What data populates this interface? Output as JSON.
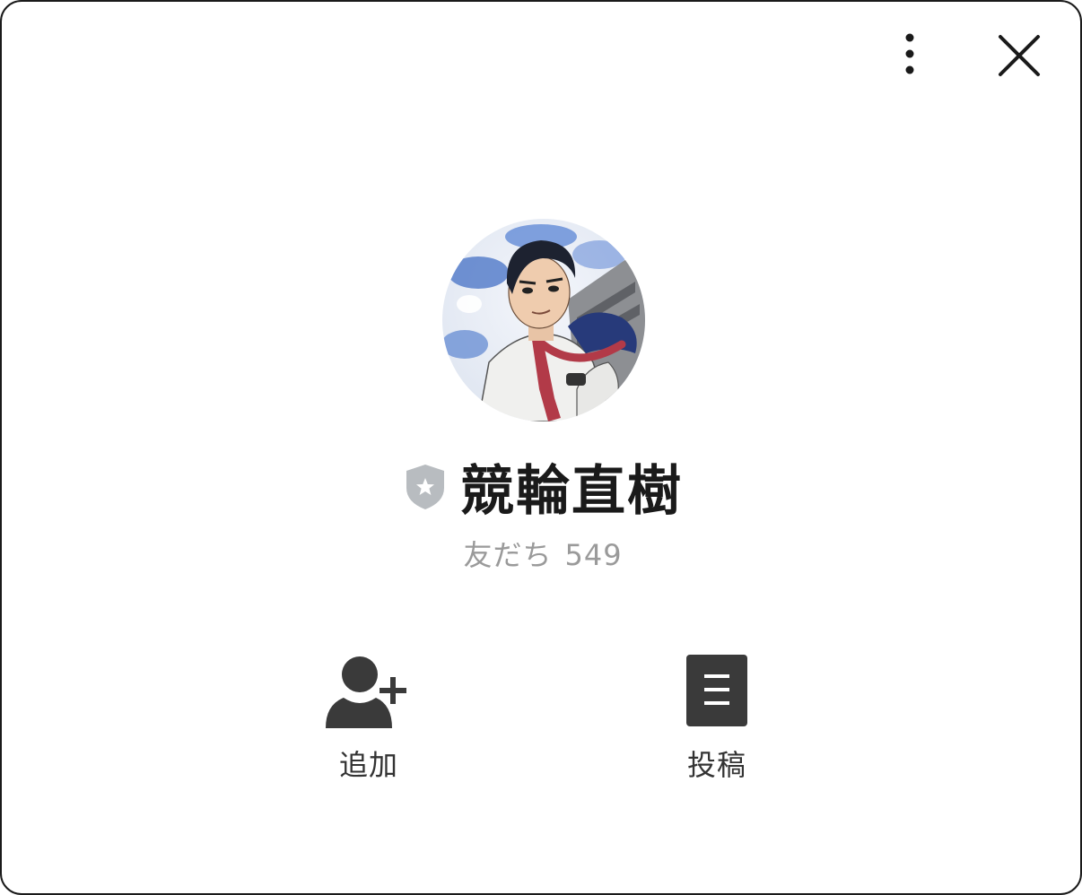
{
  "header": {
    "more_icon": "more-vertical-icon",
    "close_icon": "close-icon"
  },
  "profile": {
    "name": "競輪直樹",
    "badge_icon": "shield-star-icon",
    "friends_label": "友だち",
    "friends_count": "549",
    "avatar_description_icon": "avatar"
  },
  "actions": [
    {
      "label": "追加",
      "icon": "add-friend-icon"
    },
    {
      "label": "投稿",
      "icon": "posts-icon"
    }
  ],
  "colors": {
    "icon_dark": "#3a3a3a",
    "text_dark": "#1a1a1a",
    "text_muted": "#9a9a9a",
    "badge_gray": "#b8bcc0",
    "border": "#1a1a1a"
  }
}
